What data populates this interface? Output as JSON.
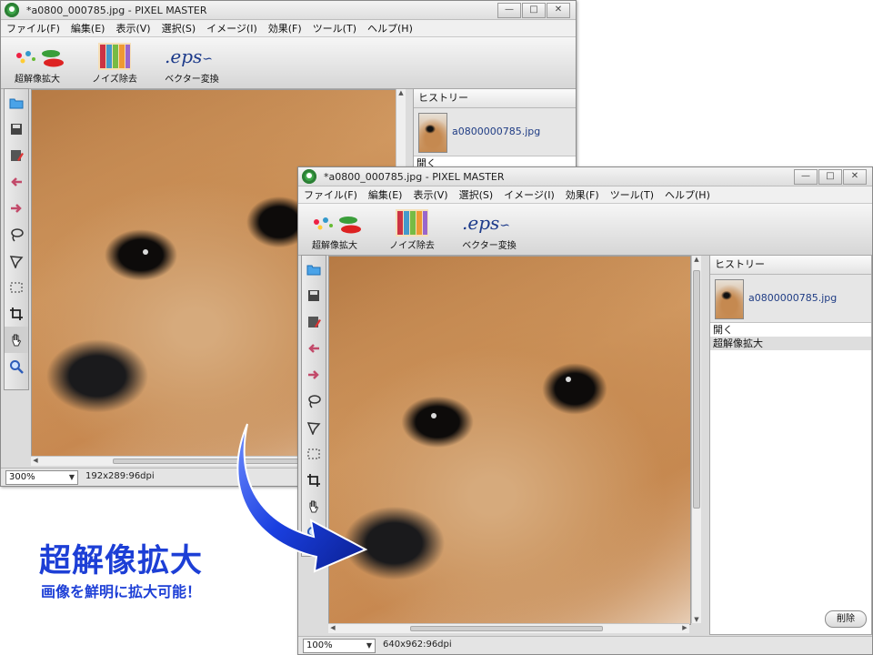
{
  "back_window": {
    "title": "*a0800_000785.jpg - PIXEL MASTER",
    "menu": [
      "ファイル(F)",
      "編集(E)",
      "表示(V)",
      "選択(S)",
      "イメージ(I)",
      "効果(F)",
      "ツール(T)",
      "ヘルプ(H)"
    ],
    "ribbon": [
      {
        "label": "超解像拡大",
        "icon": "super-resolution-icon"
      },
      {
        "label": "ノイズ除去",
        "icon": "noise-removal-icon"
      },
      {
        "label": "ベクター変換",
        "icon": "vector-eps-icon",
        "art_text": ".eps"
      }
    ],
    "history": {
      "title": "ヒストリー",
      "filename": "a0800000785.jpg",
      "items": [
        "開く"
      ]
    },
    "status": {
      "zoom": "300%",
      "dimensions": "192x289:96dpi"
    }
  },
  "front_window": {
    "title": "*a0800_000785.jpg - PIXEL MASTER",
    "menu": [
      "ファイル(F)",
      "編集(E)",
      "表示(V)",
      "選択(S)",
      "イメージ(I)",
      "効果(F)",
      "ツール(T)",
      "ヘルプ(H)"
    ],
    "ribbon": [
      {
        "label": "超解像拡大",
        "icon": "super-resolution-icon"
      },
      {
        "label": "ノイズ除去",
        "icon": "noise-removal-icon"
      },
      {
        "label": "ベクター変換",
        "icon": "vector-eps-icon",
        "art_text": ".eps"
      }
    ],
    "history": {
      "title": "ヒストリー",
      "filename": "a0800000785.jpg",
      "items": [
        "開く",
        "超解像拡大"
      ],
      "delete_label": "削除"
    },
    "status": {
      "zoom": "100%",
      "dimensions": "640x962:96dpi"
    }
  },
  "window_buttons": {
    "minimize": "—",
    "maximize": "□",
    "close": "✕"
  },
  "tools": [
    "open-folder-icon",
    "save-icon",
    "save-as-icon",
    "undo-arrow-icon",
    "redo-arrow-icon",
    "lasso-icon",
    "polygon-lasso-icon",
    "rect-select-icon",
    "crop-icon",
    "hand-icon",
    "zoom-icon"
  ],
  "caption": {
    "title": "超解像拡大",
    "subtitle": "画像を鮮明に拡大可能！"
  },
  "colors": {
    "caption": "#1d3fd6",
    "arrow": "#1a3fe0",
    "app_icon": "#3ea84a",
    "history_link": "#1f3c84"
  }
}
